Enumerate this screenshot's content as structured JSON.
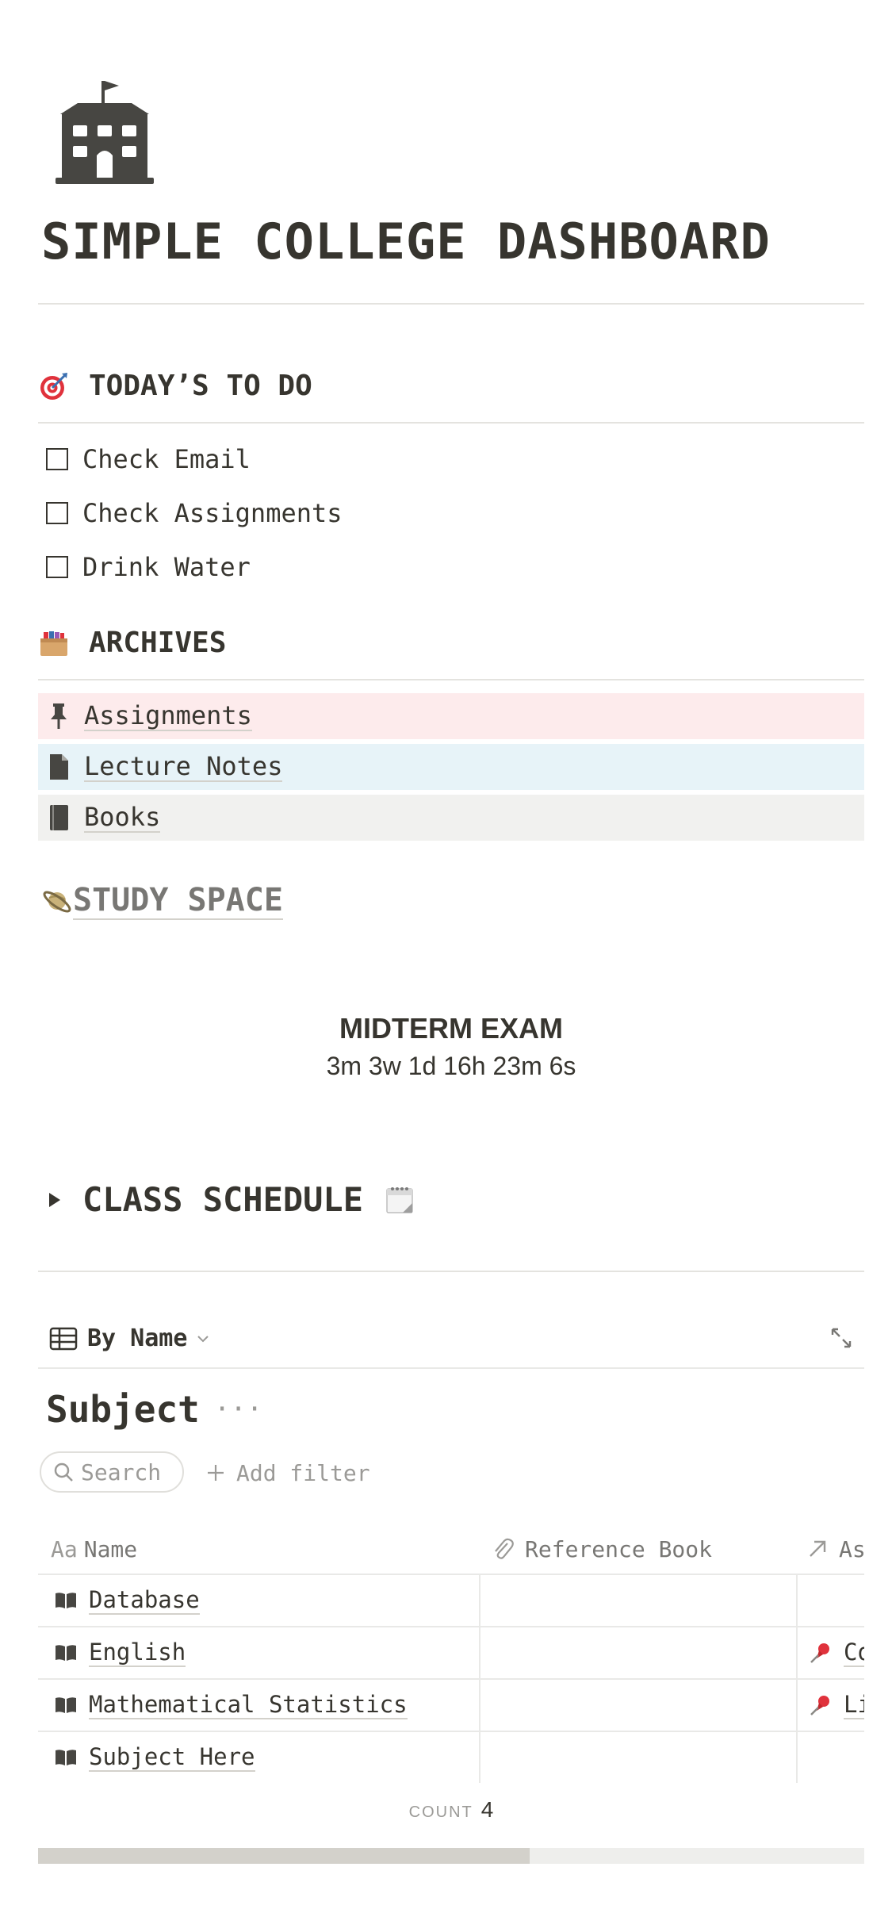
{
  "page": {
    "title": "SIMPLE COLLEGE DASHBOARD",
    "icon": "school-building-icon"
  },
  "todo": {
    "heading": "TODAY’S TO DO",
    "icon": "target-dart-icon",
    "items": [
      {
        "label": "Check Email",
        "checked": false
      },
      {
        "label": "Check Assignments",
        "checked": false
      },
      {
        "label": "Drink Water",
        "checked": false
      }
    ]
  },
  "archives": {
    "heading": "ARCHIVES",
    "icon": "card-file-box-icon",
    "items": [
      {
        "label": "Assignments",
        "icon": "pushpin-icon",
        "bg": "#fdebec"
      },
      {
        "label": "Lecture Notes",
        "icon": "document-icon",
        "bg": "#e7f3f8"
      },
      {
        "label": "Books",
        "icon": "book-icon",
        "bg": "#f1f1ef"
      }
    ]
  },
  "study_space": {
    "label": "STUDY SPACE",
    "icon": "ringed-planet-icon"
  },
  "countdown": {
    "title": "MIDTERM EXAM",
    "value": "3m 3w 1d 16h 23m 6s"
  },
  "schedule": {
    "label": "CLASS SCHEDULE",
    "icon": "spiral-calendar-icon"
  },
  "database": {
    "view_label": "By Name",
    "title": "Subject",
    "more": "···",
    "search_placeholder": "Search",
    "add_filter": "Add filter",
    "columns": [
      {
        "prefix": "Aa",
        "label": "Name"
      },
      {
        "label": "Reference Book",
        "icon": "paperclip-icon"
      },
      {
        "label": "As",
        "icon": "arrow-up-right-icon"
      }
    ],
    "rows": [
      {
        "name": "Database",
        "reference": "",
        "assign": ""
      },
      {
        "name": "English",
        "reference": "",
        "assign": "Co"
      },
      {
        "name": "Mathematical Statistics",
        "reference": "",
        "assign": "Li"
      },
      {
        "name": "Subject Here",
        "reference": "",
        "assign": ""
      }
    ],
    "count_label": "COUNT",
    "count_value": "4",
    "scroll_fraction": 0.595
  },
  "colors": {
    "text": "#37352f",
    "muted": "#787774",
    "divider": "#e4e3df"
  }
}
